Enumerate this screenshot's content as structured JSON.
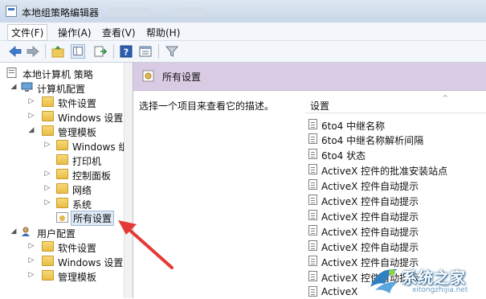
{
  "window": {
    "title": "本地组策略编辑器"
  },
  "menu": [
    "文件(F)",
    "操作(A)",
    "查看(V)",
    "帮助(H)"
  ],
  "toolbar_icons": [
    "back-icon",
    "forward-icon",
    "up-folder-icon",
    "show-hide-tree-icon",
    "export-list-icon",
    "help-icon",
    "properties-icon",
    "filter-icon"
  ],
  "tree": {
    "root": "本地计算机 策略",
    "computer_config": "计算机配置",
    "software_settings": "软件设置",
    "windows_settings": "Windows 设置",
    "admin_templates": "管理模板",
    "windows_components": "Windows 组件",
    "printers": "打印机",
    "control_panel": "控制面板",
    "network": "网络",
    "system": "系统",
    "all_settings": "所有设置",
    "user_config": "用户配置",
    "user_software_settings": "软件设置",
    "user_windows_settings": "Windows 设置",
    "user_admin_templates": "管理模板"
  },
  "right": {
    "header_title": "所有设置",
    "description": "选择一个项目来查看它的描述。",
    "column_setting": "设置",
    "items": [
      "6to4 中继名称",
      "6to4 中继名称解析间隔",
      "6to4 状态",
      "ActiveX 控件的批准安装站点",
      "ActiveX 控件自动提示",
      "ActiveX 控件自动提示",
      "ActiveX 控件自动提示",
      "ActiveX 控件自动提示",
      "ActiveX 控件自动提示",
      "ActiveX 控件自动提示",
      "ActiveX 控件自动提示",
      "ActiveX"
    ]
  },
  "watermark": {
    "brand": "系统之家",
    "url": "xitongzhijia.net"
  },
  "colors": {
    "header_bg": "#d9cbe3",
    "menubar_bg": "#f3f6fa",
    "arrow": "#e53935"
  }
}
